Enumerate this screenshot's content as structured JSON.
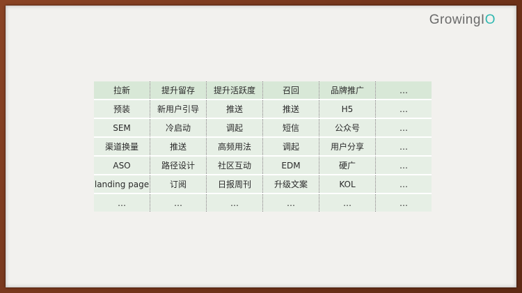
{
  "logo": {
    "main": "GrowingI",
    "accent": "O"
  },
  "table": {
    "headers": [
      "拉新",
      "提升留存",
      "提升活跃度",
      "召回",
      "品牌推广",
      "…"
    ],
    "rows": [
      [
        "预装",
        "新用户引导",
        "推送",
        "推送",
        "H5",
        "…"
      ],
      [
        "SEM",
        "冷启动",
        "调起",
        "短信",
        "公众号",
        "…"
      ],
      [
        "渠道换量",
        "推送",
        "高频用法",
        "调起",
        "用户分享",
        "…"
      ],
      [
        "ASO",
        "路径设计",
        "社区互动",
        "EDM",
        "硬广",
        "…"
      ],
      [
        "landing page",
        "订阅",
        "日报周刊",
        "升级文案",
        "KOL",
        "…"
      ],
      [
        "…",
        "…",
        "…",
        "…",
        "…",
        "…"
      ]
    ]
  }
}
